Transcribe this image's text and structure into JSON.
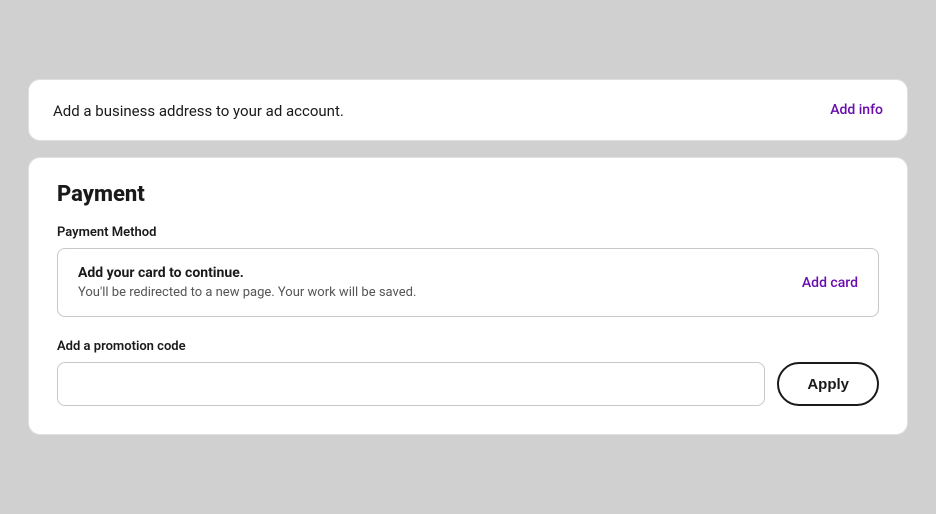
{
  "topCard": {
    "message": "Add a business address to your ad account.",
    "addInfoLabel": "Add info"
  },
  "paymentCard": {
    "title": "Payment",
    "paymentMethodLabel": "Payment Method",
    "methodBox": {
      "title": "Add your card to continue.",
      "subtitle": "You'll be redirected to a new page. Your work will be saved.",
      "addCardLabel": "Add card"
    },
    "promotionLabel": "Add a promotion code",
    "promoPlaceholder": "",
    "applyLabel": "Apply"
  }
}
